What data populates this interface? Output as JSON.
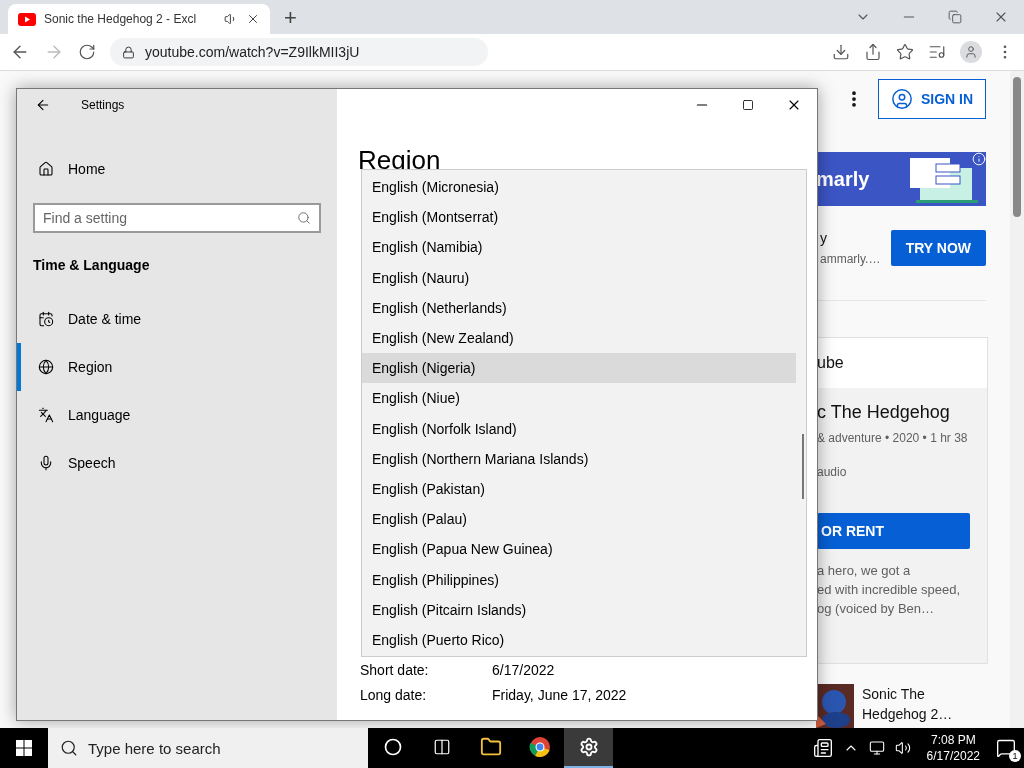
{
  "browser": {
    "tab": {
      "title": "Sonic the Hedgehog 2 - Excl",
      "selected": true
    },
    "new_tab": "+",
    "address": "youtube.com/watch?v=Z9IlkMII3jU"
  },
  "youtube": {
    "sign_in": "SIGN IN",
    "ad": {
      "brand_fragment": "marly"
    },
    "promo": {
      "line_1": "y",
      "line_2": "ammarly.…",
      "button": "TRY NOW"
    },
    "card": {
      "header": "ube",
      "title": "c The Hedgehog",
      "meta": "& adventure • 2020 • 1 hr 38",
      "audio": "audio",
      "button": "OR RENT",
      "description": [
        "a hero, we got a",
        "ed with incredible speed,",
        "og (voiced by Ben…"
      ]
    },
    "up_next": {
      "title": "Sonic The Hedgehog 2…"
    }
  },
  "settings": {
    "title": "Settings",
    "home": "Home",
    "search": {
      "placeholder": "Find a setting"
    },
    "section": "Time & Language",
    "nav": [
      {
        "kind": "datetime",
        "label": "Date & time",
        "selected": false
      },
      {
        "kind": "region",
        "label": "Region",
        "selected": true
      },
      {
        "kind": "language",
        "label": "Language",
        "selected": false
      },
      {
        "kind": "speech",
        "label": "Speech",
        "selected": false
      }
    ],
    "page_title": "Region",
    "dropdown": [
      {
        "label": "English (Micronesia)",
        "selected": false
      },
      {
        "label": "English (Montserrat)",
        "selected": false
      },
      {
        "label": "English (Namibia)",
        "selected": false
      },
      {
        "label": "English (Nauru)",
        "selected": false
      },
      {
        "label": "English (Netherlands)",
        "selected": false
      },
      {
        "label": "English (New Zealand)",
        "selected": false
      },
      {
        "label": "English (Nigeria)",
        "selected": true
      },
      {
        "label": "English (Niue)",
        "selected": false
      },
      {
        "label": "English (Norfolk Island)",
        "selected": false
      },
      {
        "label": "English (Northern Mariana Islands)",
        "selected": false
      },
      {
        "label": "English (Pakistan)",
        "selected": false
      },
      {
        "label": "English (Palau)",
        "selected": false
      },
      {
        "label": "English (Papua New Guinea)",
        "selected": false
      },
      {
        "label": "English (Philippines)",
        "selected": false
      },
      {
        "label": "English (Pitcairn Islands)",
        "selected": false
      },
      {
        "label": "English (Puerto Rico)",
        "selected": false
      }
    ],
    "formats": [
      {
        "label": "Short date:",
        "value": "6/17/2022"
      },
      {
        "label": "Long date:",
        "value": "Friday, June 17, 2022"
      }
    ]
  },
  "taskbar": {
    "search": {
      "placeholder": "Type here to search"
    },
    "apps": [
      {
        "kind": "cortana",
        "selected": false
      },
      {
        "kind": "taskview",
        "selected": false
      },
      {
        "kind": "explorer",
        "selected": false
      },
      {
        "kind": "chrome",
        "selected": false
      },
      {
        "kind": "settings",
        "selected": true
      }
    ],
    "time": "7:08 PM",
    "date": "6/17/2022",
    "notifications": "1"
  }
}
